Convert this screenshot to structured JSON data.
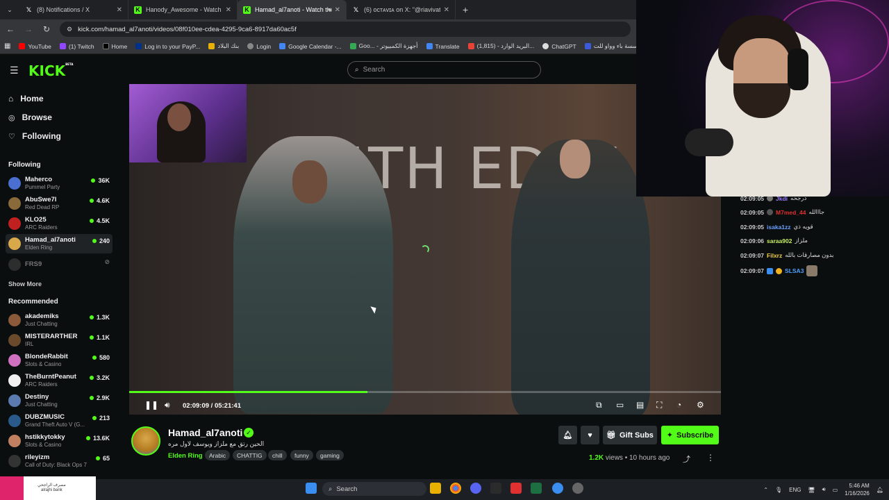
{
  "tabs": [
    {
      "title": "(8) Notifications / X",
      "icon": "x-icon",
      "color": "#000000",
      "active": false
    },
    {
      "title": "Hanody_Awesome - Watch the",
      "icon": "kick-icon",
      "color": "#53fc18",
      "active": false
    },
    {
      "title": "Hamad_al7anoti - Watch the",
      "icon": "kick-icon",
      "color": "#53fc18",
      "active": true
    },
    {
      "title": "(6) ᴏᴄᴛᴀᴠɪᴀ on X: \"@riavivatu @",
      "icon": "x-icon",
      "color": "#000000",
      "active": false
    }
  ],
  "browser": {
    "url": "kick.com/hamad_al7anoti/videos/08f010ee-cdea-4295-9ca6-8917da60ac5f",
    "new_tab": "+"
  },
  "bookmarks": [
    {
      "label": "YouTube",
      "color": "#ff0000"
    },
    {
      "label": "(1) Twitch",
      "color": "#9146ff"
    },
    {
      "label": "Home",
      "color": "#000000"
    },
    {
      "label": "Log in to your PayP...",
      "color": "#003087"
    },
    {
      "label": "بنك البلاد",
      "color": "#e8b100"
    },
    {
      "label": "Login",
      "color": "#888888"
    },
    {
      "label": "Google Calendar -...",
      "color": "#4285f4"
    },
    {
      "label": "Goo... - أجهزة الكمبيوتر",
      "color": "#34a853"
    },
    {
      "label": "Translate",
      "color": "#4285f4"
    },
    {
      "label": "(1,815) - البريد الوارد...",
      "color": "#ea4335"
    },
    {
      "label": "ChatGPT",
      "color": "#dddddd"
    },
    {
      "label": "مؤسسة باء وواو للت...",
      "color": "#3b5bdb"
    }
  ],
  "header": {
    "logo": "KICK",
    "logo_badge": "BETA",
    "search_placeholder": "Search"
  },
  "nav": [
    {
      "label": "Home",
      "icon": "home-icon"
    },
    {
      "label": "Browse",
      "icon": "compass-icon"
    },
    {
      "label": "Following",
      "icon": "heart-icon"
    }
  ],
  "following": {
    "heading": "Following",
    "show_more": "Show More",
    "channels": [
      {
        "name": "Maherco",
        "game": "Pummel Party",
        "viewers": "36K",
        "color": "#4a6fd0"
      },
      {
        "name": "AbuSwe7l",
        "game": "Red Dead RP",
        "viewers": "4.6K",
        "color": "#8a6a3a"
      },
      {
        "name": "KLO25",
        "game": "ARC Raiders",
        "viewers": "4.5K",
        "color": "#c02020"
      },
      {
        "name": "Hamad_al7anoti",
        "game": "Elden Ring",
        "viewers": "240",
        "color": "#d9a84a"
      },
      {
        "name": "FRS9",
        "game": "",
        "viewers": "",
        "color": "#555555"
      }
    ]
  },
  "recommended": {
    "heading": "Recommended",
    "channels": [
      {
        "name": "akademiks",
        "game": "Just Chatting",
        "viewers": "1.3K",
        "color": "#8a5a3a"
      },
      {
        "name": "MISTERARTHER",
        "game": "IRL",
        "viewers": "1.1K",
        "color": "#6a4a2a"
      },
      {
        "name": "BlondeRabbit",
        "game": "Slots & Casino",
        "viewers": "580",
        "color": "#d070c0"
      },
      {
        "name": "TheBurntPeanut",
        "game": "ARC Raiders",
        "viewers": "3.2K",
        "color": "#f0f0f0"
      },
      {
        "name": "Destiny",
        "game": "Just Chatting",
        "viewers": "2.9K",
        "color": "#5a7ab0"
      },
      {
        "name": "DUBZMUSIC",
        "game": "Grand Theft Auto V (G...",
        "viewers": "213",
        "color": "#2a5a8a"
      },
      {
        "name": "hstikkytokky",
        "game": "Slots & Casino",
        "viewers": "13.6K",
        "color": "#c08060"
      },
      {
        "name": "rileyizm",
        "game": "Call of Duty: Black Ops 7",
        "viewers": "65",
        "color": "#333333"
      }
    ]
  },
  "video": {
    "stage_text": "5TH EDITI",
    "stage_sup": "TH",
    "current_time": "02:09:09",
    "separator": "/",
    "duration": "05:21:41",
    "progress_fraction": 0.403,
    "accent": "#53fc18"
  },
  "stream": {
    "name": "Hamad_al7anoti",
    "title": "الحين رتق مع ملزاز ويوسف لاول مره",
    "game": "Elden Ring",
    "tags": [
      "Arabic",
      "CHATTIG",
      "chill",
      "funny",
      "gaming"
    ],
    "views_count": "1.2K",
    "views_label": "views",
    "age": "10 hours ago",
    "gift_label": "Gift Subs",
    "subscribe_label": "Subscribe"
  },
  "chat": [
    {
      "time": "02:09:05",
      "user": "Jkdi",
      "text": "درجحه",
      "color": "#9b7bff"
    },
    {
      "time": "02:09:05",
      "user": "M7med_44",
      "text": "جااالله",
      "color": "#e03030"
    },
    {
      "time": "02:09:05",
      "user": "isaka1zz",
      "text": "قويه ذي",
      "color": "#6aa0ff"
    },
    {
      "time": "02:09:06",
      "user": "saraa902",
      "text": "ملزاز",
      "color": "#c8f060"
    },
    {
      "time": "02:09:07",
      "user": "Filxrz",
      "text": "بدون مصارقات بالله",
      "color": "#f0d040"
    },
    {
      "time": "02:09:07",
      "user": "SLSA3",
      "text": "",
      "color": "#4fa0ff"
    }
  ],
  "taskbar": {
    "search": "Search",
    "bank_name": "مصرف الراجحي",
    "bank_latin": "alrajhi bank",
    "lang": "ENG",
    "time": "5:46 AM",
    "date": "1/16/2026"
  }
}
